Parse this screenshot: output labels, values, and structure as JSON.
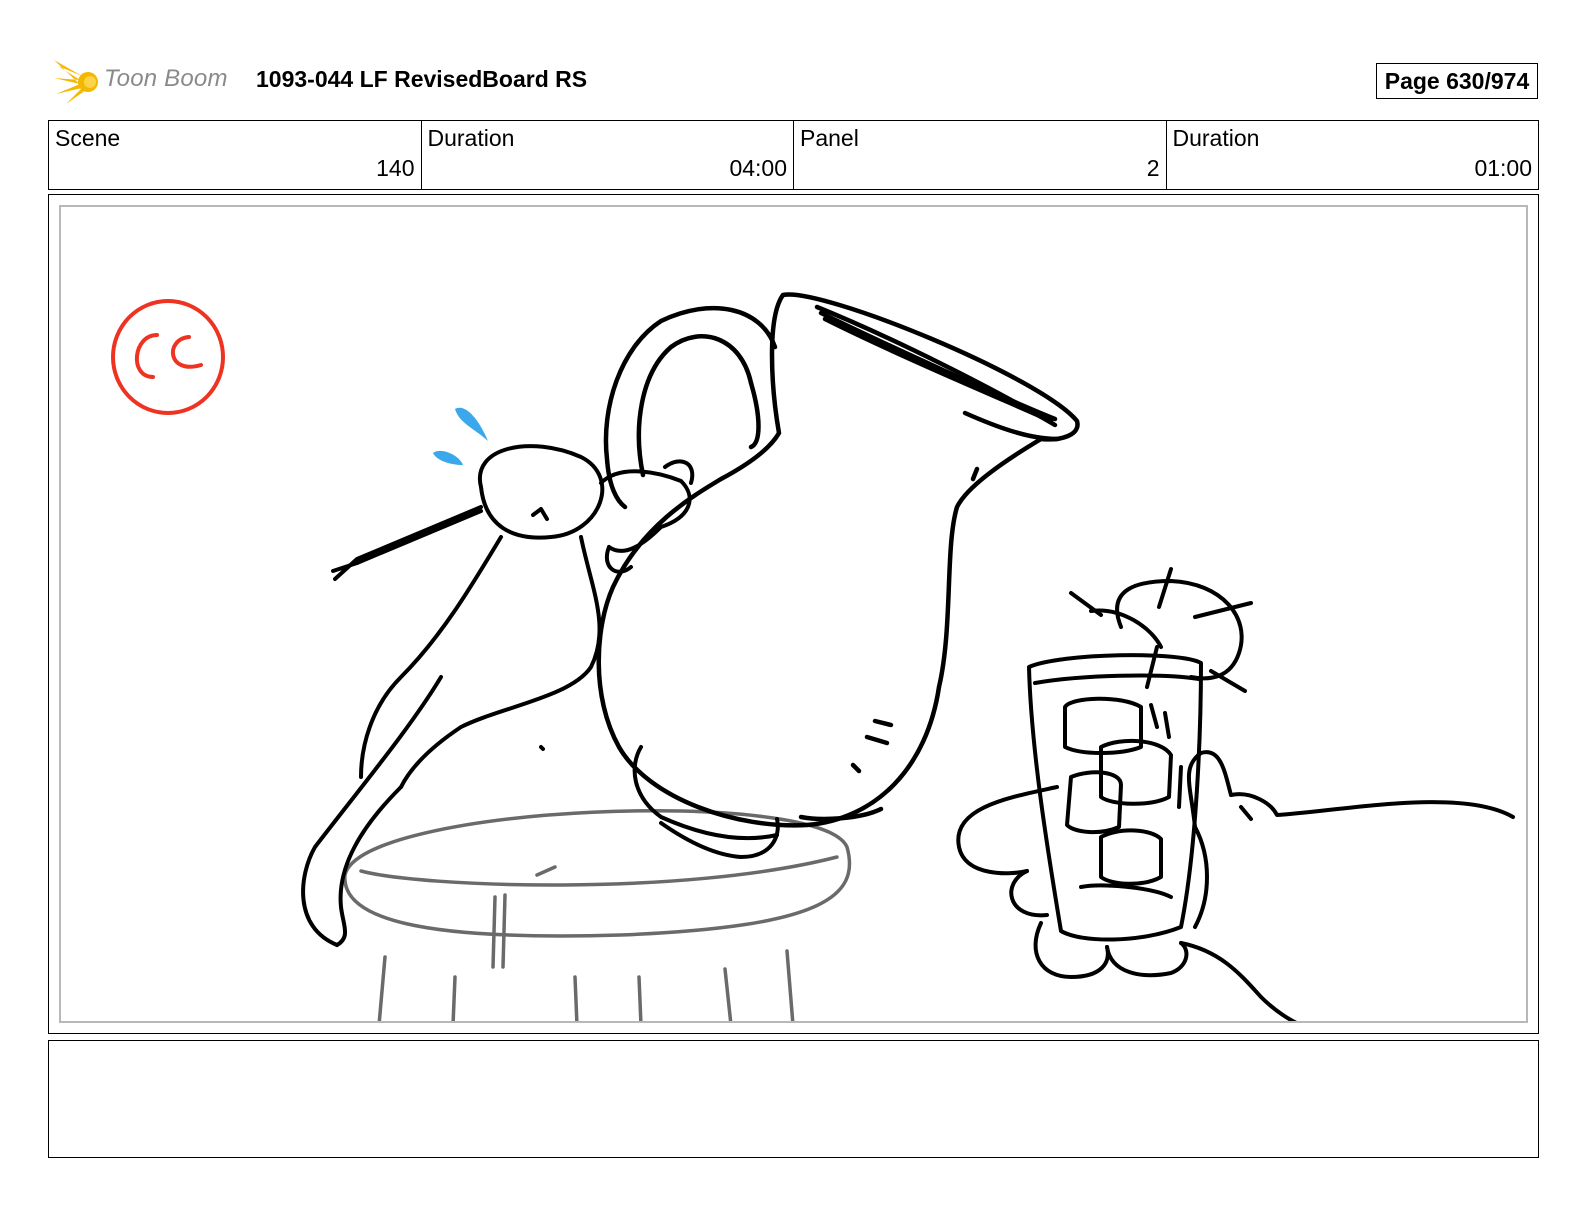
{
  "header": {
    "logo_text": "Toon Boom",
    "title": "1093-044 LF RevisedBoard RS",
    "page": "Page 630/974"
  },
  "info": {
    "scene_label": "Scene",
    "scene_value": "140",
    "scene_duration_label": "Duration",
    "scene_duration_value": "04:00",
    "panel_label": "Panel",
    "panel_value": "2",
    "panel_duration_label": "Duration",
    "panel_duration_value": "01:00"
  },
  "colors": {
    "logo_star": "#f5b800",
    "cc_mark": "#ee3322",
    "sweat_drops": "#3aa8ea",
    "stool": "#6a6a6a"
  },
  "caption": {
    "text": ""
  }
}
